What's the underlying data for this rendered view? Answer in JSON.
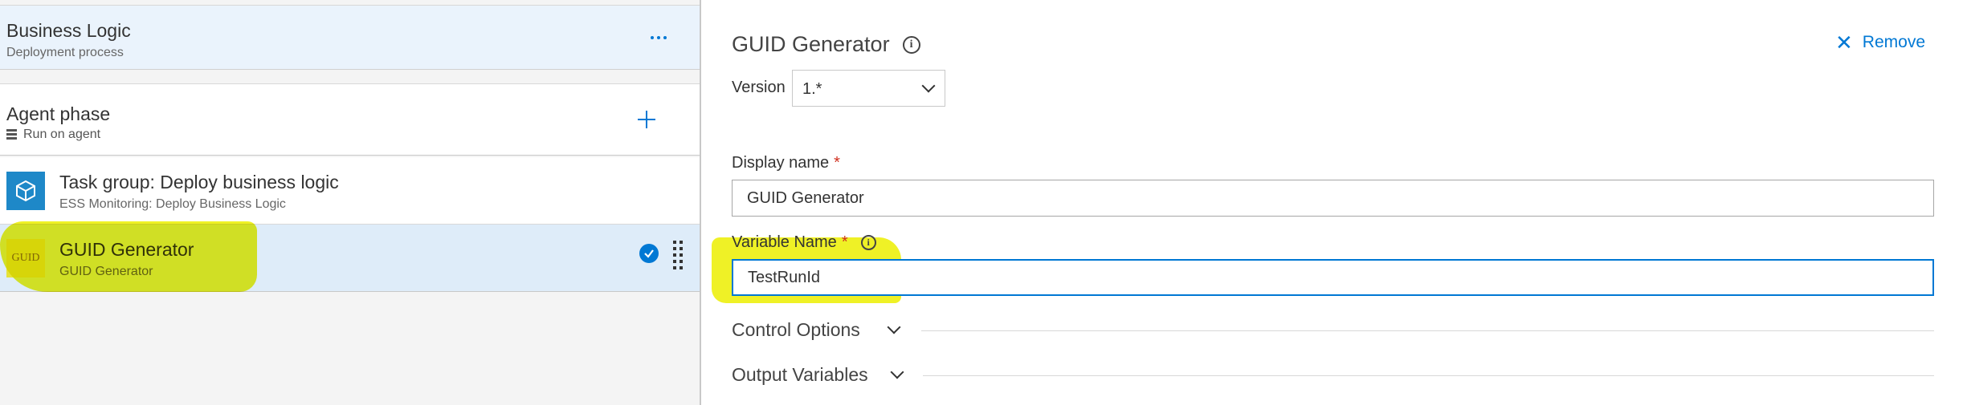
{
  "left_pane": {
    "process": {
      "title": "Business Logic",
      "subtitle": "Deployment process",
      "more_label": "..."
    },
    "phase": {
      "title": "Agent phase",
      "subtitle": "Run on agent"
    },
    "tasks": [
      {
        "title": "Task group: Deploy business logic",
        "subtitle": "ESS Monitoring: Deploy Business Logic",
        "icon": "task-group-icon"
      },
      {
        "title": "GUID Generator",
        "subtitle": "GUID Generator",
        "icon_text": "GUID",
        "icon": "guid-icon",
        "selected": true,
        "status": "check-circle-icon"
      }
    ]
  },
  "right_pane": {
    "title": "GUID Generator",
    "remove_label": "Remove",
    "version": {
      "label": "Version",
      "value": "1.*"
    },
    "display_name": {
      "label": "Display name",
      "required_mark": "*",
      "value": "GUID Generator"
    },
    "variable_name": {
      "label": "Variable Name",
      "required_mark": "*",
      "value": "TestRunId"
    },
    "sections": [
      {
        "title": "Control Options"
      },
      {
        "title": "Output Variables"
      }
    ]
  },
  "colors": {
    "accent": "#0078d4",
    "selected_row": "#deecf9",
    "header_row": "#eaf3fc",
    "required": "#d0301f",
    "highlighter": "#ecee00",
    "task_group_icon": "#1e88c8",
    "guid_icon": "#e6e23a"
  }
}
